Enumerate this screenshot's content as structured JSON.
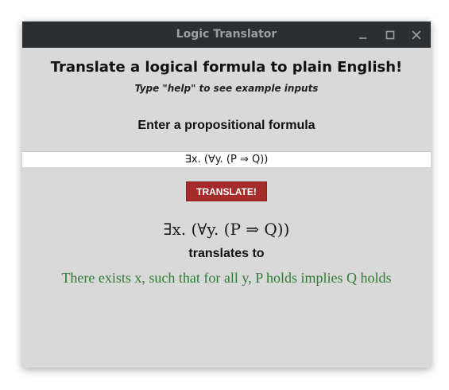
{
  "window": {
    "title": "Logic Translator",
    "controls": [
      "minimize-icon",
      "maximize-icon",
      "close-icon"
    ]
  },
  "main": {
    "heading": "Translate a logical formula to plain English!",
    "subheading": "Type \"help\" to see example inputs",
    "prompt": "Enter a propositional formula",
    "input_value": "∃x. (∀y. (P ⇒ Q))",
    "button_label": "TRANSLATE!",
    "result_formula": "∃x. (∀y. (P ⇒ Q))",
    "translates_to": "translates to",
    "result_english": "There exists x, such that for all y, P holds implies Q holds"
  },
  "colors": {
    "titlebar": "#2b2f31",
    "background": "#d9d9d9",
    "button": "#a52a2a",
    "result_text": "#2e7d32"
  }
}
